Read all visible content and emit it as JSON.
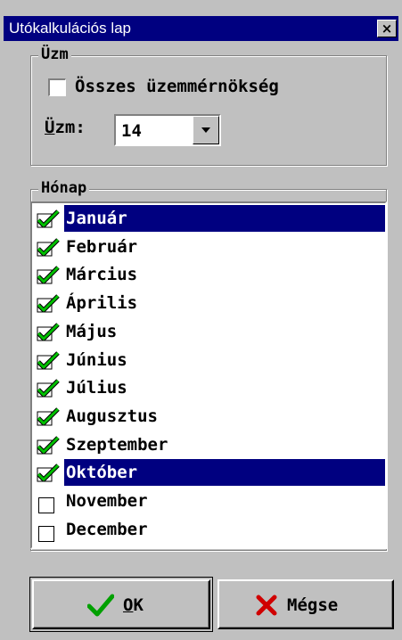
{
  "window": {
    "title": "Utókalkulációs lap",
    "close_glyph": "×"
  },
  "plant_group": {
    "legend": "Üzm",
    "all_checkbox_label": "Összes üzemmérnökség",
    "all_checked": false,
    "combo_label_prefix": "Ü",
    "combo_label_rest": "zm:",
    "combo_value": "14"
  },
  "month_group": {
    "legend": "Hónap",
    "items": [
      {
        "label": "Január",
        "checked": true,
        "selected": true
      },
      {
        "label": "Február",
        "checked": true,
        "selected": false
      },
      {
        "label": "Március",
        "checked": true,
        "selected": false
      },
      {
        "label": "Április",
        "checked": true,
        "selected": false
      },
      {
        "label": "Május",
        "checked": true,
        "selected": false
      },
      {
        "label": "Június",
        "checked": true,
        "selected": false
      },
      {
        "label": "Július",
        "checked": true,
        "selected": false
      },
      {
        "label": "Augusztus",
        "checked": true,
        "selected": false
      },
      {
        "label": "Szeptember",
        "checked": true,
        "selected": false
      },
      {
        "label": "Október",
        "checked": true,
        "selected": true
      },
      {
        "label": "November",
        "checked": false,
        "selected": false
      },
      {
        "label": "December",
        "checked": false,
        "selected": false
      }
    ]
  },
  "buttons": {
    "ok_underlined": "O",
    "ok_rest": "K",
    "ok_icon": "green-checkmark-icon",
    "cancel_label": "Mégse",
    "cancel_icon": "red-x-icon"
  },
  "colors": {
    "titlebar": "#000080",
    "face": "#c0c0c0",
    "selection": "#000080",
    "check_green": "#00c000",
    "cancel_red": "#e00000"
  }
}
